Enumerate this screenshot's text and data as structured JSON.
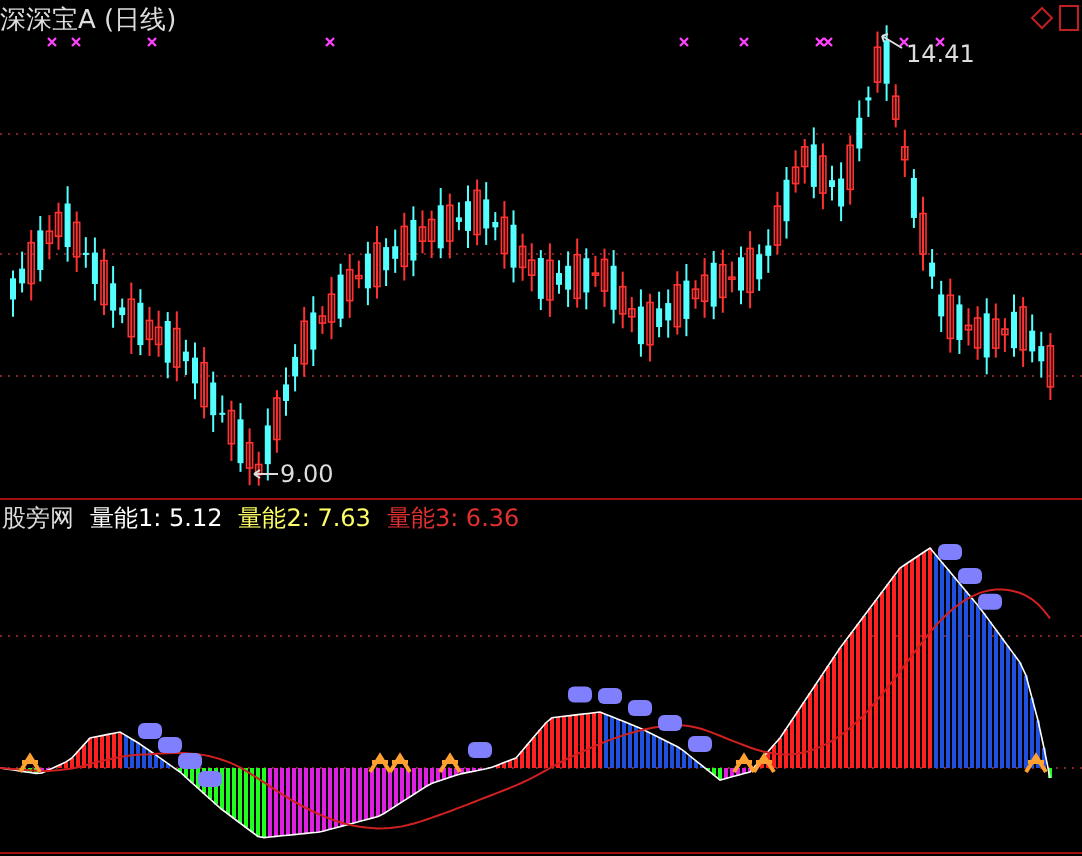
{
  "chart_title": "深深宝A (日线)",
  "price_chart": {
    "high_label": "14.41",
    "low_label": "9.00"
  },
  "indicator": {
    "name": "股旁网",
    "legend": [
      {
        "text": "量能1: 5.12",
        "color": "#ffffff"
      },
      {
        "text": "量能2: 7.63",
        "color": "#ffff66"
      },
      {
        "text": "量能3: 6.36",
        "color": "#e03030"
      }
    ]
  }
}
